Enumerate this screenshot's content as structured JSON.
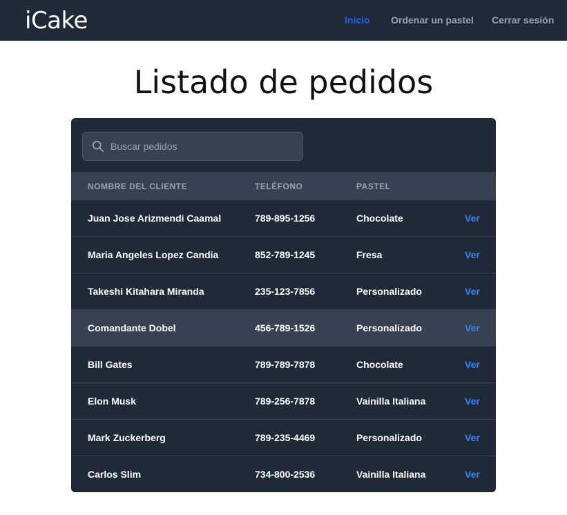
{
  "navbar": {
    "logo": "iCake",
    "links": [
      {
        "label": "Inicio",
        "active": true
      },
      {
        "label": "Ordenar un pastel",
        "active": false
      },
      {
        "label": "Cerrar sesión",
        "active": false
      }
    ]
  },
  "page": {
    "title": "Listado de pedidos"
  },
  "search": {
    "placeholder": "Buscar pedidos",
    "value": ""
  },
  "table": {
    "headers": [
      "NOMBRE DEL CLIENTE",
      "TELÉFONO",
      "PASTEL"
    ],
    "action_label": "Ver",
    "highlighted_row": 3,
    "rows": [
      {
        "name": "Juan Jose Arizmendi Caamal",
        "phone": "789-895-1256",
        "cake": "Chocolate"
      },
      {
        "name": "Maria Angeles Lopez Candia",
        "phone": "852-789-1245",
        "cake": "Fresa"
      },
      {
        "name": "Takeshi Kitahara Miranda",
        "phone": "235-123-7856",
        "cake": "Personalizado"
      },
      {
        "name": "Comandante Dobel",
        "phone": "456-789-1526",
        "cake": "Personalizado"
      },
      {
        "name": "Bill Gates",
        "phone": "789-789-7878",
        "cake": "Chocolate"
      },
      {
        "name": "Elon Musk",
        "phone": "789-256-7878",
        "cake": "Vainilla Italiana"
      },
      {
        "name": "Mark Zuckerberg",
        "phone": "789-235-4469",
        "cake": "Personalizado"
      },
      {
        "name": "Carlos Slim",
        "phone": "734-800-2536",
        "cake": "Vainilla Italiana"
      }
    ]
  },
  "colors": {
    "navbar_bg": "#1f2937",
    "card_bg": "#1f2937",
    "header_bg": "#374151",
    "accent_link": "#3b82f6",
    "active_nav": "#2563eb"
  },
  "icons": {
    "search": "search-icon"
  }
}
